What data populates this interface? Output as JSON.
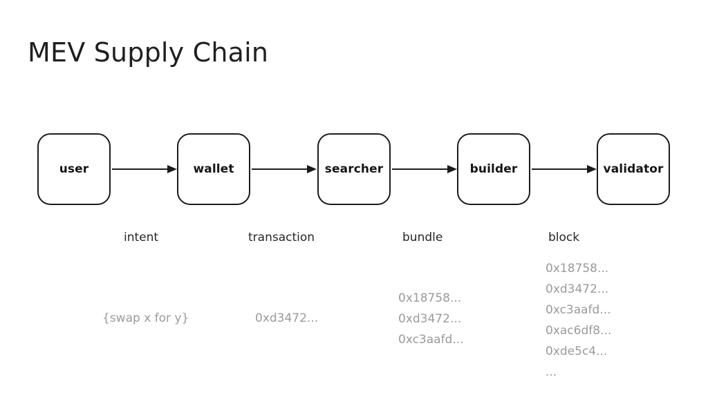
{
  "diagram": {
    "title": "MEV Supply Chain",
    "background_color": "#ffffff",
    "node_border_color": "#1b1b1b",
    "node_text_color": "#151515",
    "label_text_color": "#262626",
    "muted_text_color": "#9a9a9a",
    "nodes": [
      {
        "id": "user",
        "label": "user"
      },
      {
        "id": "wallet",
        "label": "wallet"
      },
      {
        "id": "searcher",
        "label": "searcher"
      },
      {
        "id": "builder",
        "label": "builder"
      },
      {
        "id": "validator",
        "label": "validator"
      }
    ],
    "edges": [
      {
        "from": "user",
        "to": "wallet",
        "label": "intent"
      },
      {
        "from": "wallet",
        "to": "searcher",
        "label": "transaction"
      },
      {
        "from": "searcher",
        "to": "builder",
        "label": "bundle"
      },
      {
        "from": "builder",
        "to": "validator",
        "label": "block"
      }
    ],
    "columns": [
      {
        "title": "intent",
        "items": [
          "{swap x for y}"
        ]
      },
      {
        "title": "transaction",
        "items": [
          "0xd3472..."
        ]
      },
      {
        "title": "bundle",
        "items": [
          "0x18758...",
          "0xd3472...",
          "0xc3aafd..."
        ]
      },
      {
        "title": "block",
        "items": [
          "0x18758...",
          "0xd3472...",
          "0xc3aafd...",
          "0xac6df8...",
          "0xde5c4...",
          "..."
        ]
      }
    ]
  }
}
